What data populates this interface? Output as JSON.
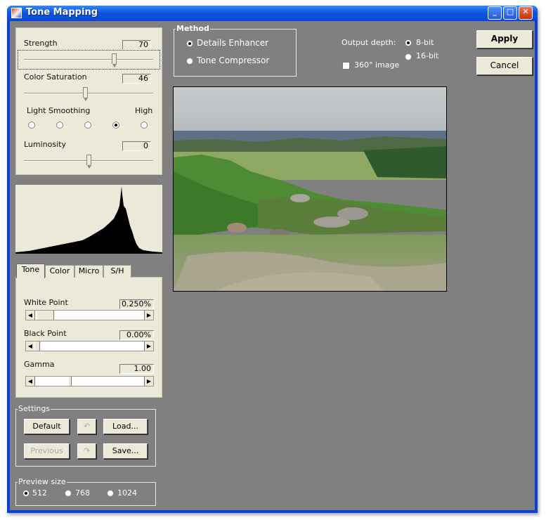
{
  "window": {
    "title": "Tone Mapping",
    "minimize_glyph": "_",
    "maximize_glyph": "□",
    "close_glyph": "✕"
  },
  "adjust": {
    "strength": {
      "label": "Strength",
      "value": "70"
    },
    "color_saturation": {
      "label": "Color Saturation",
      "value": "46"
    },
    "light_smoothing": {
      "label": "Light Smoothing",
      "high_label": "High",
      "options_count": 5,
      "selected_index": 3
    },
    "luminosity": {
      "label": "Luminosity",
      "value": "0"
    }
  },
  "tabs": [
    "Tone",
    "Color",
    "Micro",
    "S/H"
  ],
  "tone": {
    "white_point": {
      "label": "White Point",
      "value": "0.250%"
    },
    "black_point": {
      "label": "Black Point",
      "value": "0.00%"
    },
    "gamma": {
      "label": "Gamma",
      "value": "1.00"
    }
  },
  "settings": {
    "group_label": "Settings",
    "default_label": "Default",
    "load_label": "Load...",
    "previous_label": "Previous",
    "save_label": "Save...",
    "undo_glyph": "↶",
    "redo_glyph": "↷"
  },
  "preview_size": {
    "group_label": "Preview size",
    "options": [
      "512",
      "768",
      "1024"
    ],
    "selected": "512"
  },
  "method": {
    "group_label": "Method",
    "options": [
      "Details Enhancer",
      "Tone Compressor"
    ],
    "selected": "Details Enhancer"
  },
  "output": {
    "depth_label": "Output depth:",
    "options": [
      "8-bit",
      "16-bit"
    ],
    "selected": "8-bit",
    "panorama_label": "360° image",
    "panorama_checked": false
  },
  "actions": {
    "apply_label": "Apply",
    "cancel_label": "Cancel"
  },
  "colors": {
    "titlebar": "#0a55e0",
    "client_bg": "#808080",
    "panel_bg": "#ece9d8"
  }
}
